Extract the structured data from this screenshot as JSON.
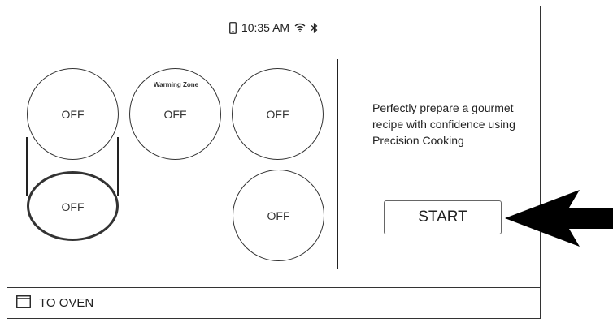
{
  "status_bar": {
    "time": "10:35 AM",
    "icons": [
      "phone-icon",
      "wifi-icon",
      "bluetooth-icon"
    ]
  },
  "burners": {
    "front_left": {
      "state": "OFF"
    },
    "warming_zone": {
      "label": "Warming Zone",
      "state": "OFF"
    },
    "front_right": {
      "state": "OFF"
    },
    "rear_left": {
      "state": "OFF"
    },
    "rear_right": {
      "state": "OFF"
    }
  },
  "promo": {
    "text": "Perfectly prepare a gourmet recipe with confidence using Precision Cooking"
  },
  "start_button": {
    "label": "START"
  },
  "bottom_bar": {
    "label": "TO OVEN",
    "icon": "oven-icon"
  },
  "colors": {
    "line": "#222222",
    "background": "#ffffff"
  }
}
